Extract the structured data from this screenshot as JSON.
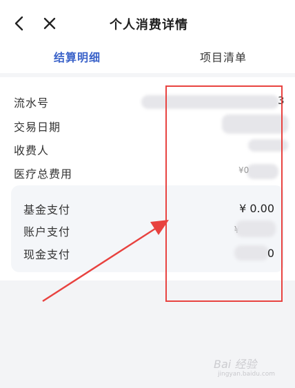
{
  "header": {
    "title": "个人消费详情",
    "back_icon": "chevron-left-icon",
    "close_icon": "close-icon"
  },
  "tabs": [
    {
      "label": "结算明细",
      "active": true
    },
    {
      "label": "项目清单",
      "active": false
    }
  ],
  "details": [
    {
      "label": "流水号",
      "value_visible": "3"
    },
    {
      "label": "交易日期",
      "value_visible": ""
    },
    {
      "label": "收费人",
      "value_visible": ""
    },
    {
      "label": "医疗总费用",
      "value_visible": "¥0"
    }
  ],
  "payments": [
    {
      "label": "基金支付",
      "value": "¥ 0.00"
    },
    {
      "label": "账户支付",
      "value": "¥"
    },
    {
      "label": "现金支付",
      "value": "0"
    }
  ],
  "colors": {
    "accent": "#3a62c9",
    "annotation": "#e8423f"
  },
  "watermark": {
    "text": "Bai 经验",
    "sub": "jingyan.baidu.com"
  }
}
